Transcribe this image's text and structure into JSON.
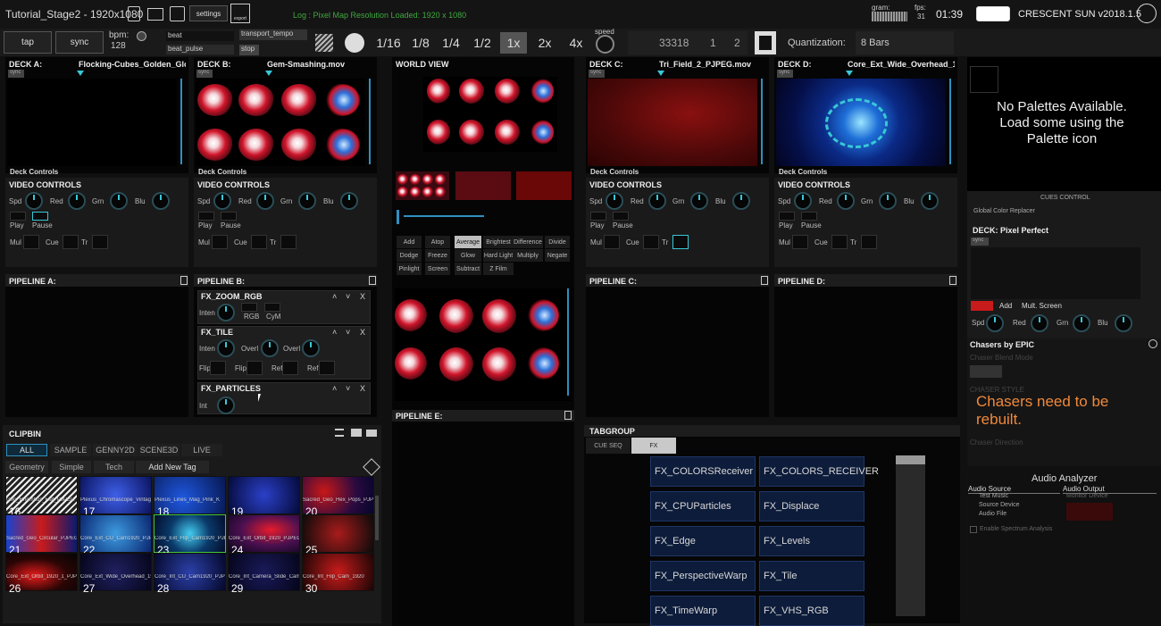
{
  "window_title": "Tutorial_Stage2 - 1920x1080",
  "top": {
    "settings": "settings",
    "export_label": "export",
    "log": "Log : Pixel Map Resolution Loaded: 1920 x 1080",
    "gram": "gram:",
    "fps_label": "fps:",
    "fps": "31",
    "time": "01:39",
    "app": "CRESCENT SUN v2018.1.5"
  },
  "transport": {
    "tap": "tap",
    "sync": "sync",
    "bpm_label": "bpm:",
    "bpm": "128",
    "beat": "beat",
    "beat_pulse": "beat_pulse",
    "transport_tempo": "transport_tempo",
    "stop_label": "stop",
    "speed": "speed",
    "rates": [
      "1/16",
      "1/8",
      "1/4",
      "1/2",
      "1x",
      "2x",
      "4x"
    ],
    "counter": "33318",
    "bar": "1",
    "beat_num": "2",
    "quantization_label": "Quantization:",
    "quantization_value": "8 Bars"
  },
  "decks": [
    {
      "label": "DECK A:",
      "clip": "Flocking-Cubes_Golden_Glo",
      "controls": "Deck Controls",
      "video": "VIDEO CONTROLS",
      "pipeline": "PIPELINE A:"
    },
    {
      "label": "DECK B:",
      "clip": "Gem-Smashing.mov",
      "controls": "Deck Controls",
      "video": "VIDEO CONTROLS",
      "pipeline": "PIPELINE B:"
    },
    {
      "label": "DECK C:",
      "clip": "Tri_Field_2_PJPEG.mov",
      "controls": "Deck Controls",
      "video": "VIDEO CONTROLS",
      "pipeline": "PIPELINE C:"
    },
    {
      "label": "DECK D:",
      "clip": "Core_Ext_Wide_Overhead_1",
      "controls": "Deck Controls",
      "video": "VIDEO CONTROLS",
      "pipeline": "PIPELINE D:"
    }
  ],
  "sync_badge": "sync",
  "vc": {
    "spd": "Spd",
    "red": "Red",
    "grn": "Grn",
    "blu": "Blu",
    "play": "Play",
    "pause": "Pause",
    "mul": "Mul",
    "cue": "Cue",
    "tr": "Tr"
  },
  "world_view": "WORLD VIEW",
  "blend_modes": [
    "Add",
    "Atop",
    "Average",
    "Brightest",
    "Difference",
    "Divide",
    "Dodge",
    "Freeze",
    "Glow",
    "Hard Light",
    "Multiply",
    "Negate",
    "Pinlight",
    "Screen",
    "Subtract",
    "Z Film"
  ],
  "pipeline_e": "PIPELINE E:",
  "fx": [
    {
      "name": "FX_ZOOM_RGB",
      "params": [
        "Inten",
        "RGB",
        "CyM"
      ]
    },
    {
      "name": "FX_TILE",
      "params": [
        "Inten",
        "Overl",
        "Overl",
        "Flip",
        "Flip",
        "Refl",
        "Refl"
      ]
    },
    {
      "name": "FX_PARTICLES",
      "params": [
        "Int"
      ]
    }
  ],
  "clipbin": {
    "title": "CLIPBIN",
    "tabs": [
      "ALL",
      "SAMPLE",
      "GENNY2D",
      "SCENE3D",
      "LIVE"
    ],
    "tags": [
      "Geometry",
      "Simple",
      "Tech",
      "Add New Tag"
    ],
    "clips": [
      {
        "n": "16",
        "cap": "Geo_Rhombus_Flat_PJPEG"
      },
      {
        "n": "17",
        "cap": "Plexus_Chromascope_Vintage"
      },
      {
        "n": "18",
        "cap": "Plexus_Lines_Mag_Pink_K"
      },
      {
        "n": "19",
        "cap": ""
      },
      {
        "n": "20",
        "cap": "Sacred_Geo_Hex_Pops_PJPEG"
      },
      {
        "n": "21",
        "cap": "Sacred_Geo_Circular_PJPEG"
      },
      {
        "n": "22",
        "cap": "Core_Ext_CU_Cam1920_PJPEG"
      },
      {
        "n": "23",
        "cap": "Core_Ext_Flip_Cam1920_PJPEG"
      },
      {
        "n": "24",
        "cap": "Core_Ext_Orbit_1920_PJPEG"
      },
      {
        "n": "25",
        "cap": ""
      },
      {
        "n": "26",
        "cap": "Core_Ext_Orbit_1920_1_PJPEG"
      },
      {
        "n": "27",
        "cap": "Core_Ext_Wide_Overhead_1920"
      },
      {
        "n": "28",
        "cap": "Core_Int_CU_Cam1920_PJPEG"
      },
      {
        "n": "29",
        "cap": "Core_Int_Camera_Slide_Cam"
      },
      {
        "n": "30",
        "cap": "Core_Int_Flip_Cam_1920"
      }
    ]
  },
  "tabgroup": {
    "title": "TABGROUP",
    "tabs": [
      "CUE SEQ",
      "FX"
    ],
    "fx_buttons": [
      "FX_COLORSReceiver",
      "FX_COLORS_RECEIVER",
      "FX_CPUParticles",
      "FX_Displace",
      "FX_Edge",
      "FX_Levels",
      "FX_PerspectiveWarp",
      "FX_Tile",
      "FX_TimeWarp",
      "FX_VHS_RGB"
    ]
  },
  "right": {
    "no_palettes": "No Palettes Available. Load some using the Palette icon",
    "cues_control": "CUES CONTROL",
    "global_color": "Global Color Replacer",
    "deck_pixel": "DECK: Pixel Perfect",
    "add": "Add",
    "mult_screen": "Mult. Screen",
    "chasers_title": "Chasers by EPIC",
    "chaser_blend": "Chaser Blend Mode",
    "chaser_style": "CHASER STYLE",
    "chasers_msg": "Chasers need to be rebuilt.",
    "chaser_direction": "Chaser Direction",
    "audio_title": "Audio Analyzer",
    "audio_source": "Audio Source",
    "audio_output": "Audio Output",
    "test_music": "Test Music",
    "source_device": "Source Device",
    "audio_file": "Audio File",
    "monitor_device": "Monitor Device",
    "spectrum": "Enable Spectrum Analysis"
  },
  "colors": {
    "accent": "#38c8d6",
    "fx_button": "#0d1c3a",
    "chaser_msg": "#f0893a",
    "highlight_red": "#c81b1b"
  }
}
